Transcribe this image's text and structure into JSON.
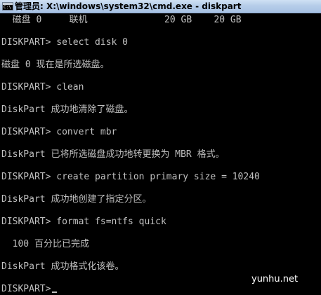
{
  "window": {
    "title": "管理员: X:\\windows\\system32\\cmd.exe - diskpart",
    "icon_label": "C:\\"
  },
  "console": {
    "lines": [
      "  磁盘 0     联机              20 GB    20 GB",
      "DISKPART> select disk 0",
      "磁盘 0 现在是所选磁盘。",
      "DISKPART> clean",
      "DiskPart 成功地清除了磁盘。",
      "DISKPART> convert mbr",
      "DiskPart 已将所选磁盘成功地转更换为 MBR 格式。",
      "DISKPART> create partition primary size = 10240",
      "DiskPart 成功地创建了指定分区。",
      "DISKPART> format fs=ntfs quick",
      "  100 百分比已完成",
      "DiskPart 成功格式化该卷。",
      "DISKPART>"
    ]
  },
  "watermark": "yunhu.net",
  "colors": {
    "console_text": "#c0c0c0",
    "console_background": "#000000",
    "titlebar": "#b6cde9"
  }
}
